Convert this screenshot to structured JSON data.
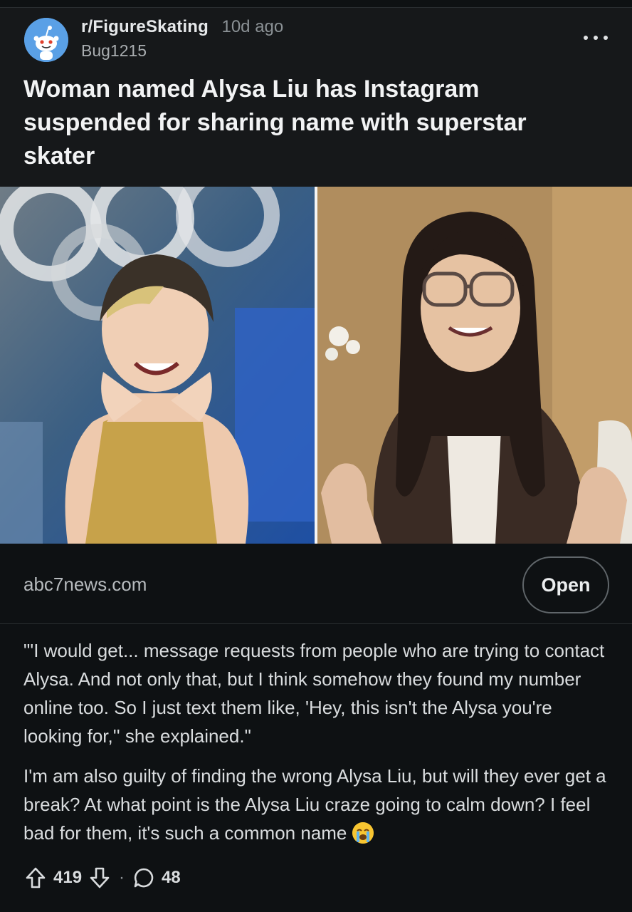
{
  "post": {
    "subreddit": "r/FigureSkating",
    "age": "10d ago",
    "author": "Bug1215",
    "title": "Woman named Alysa Liu has Instagram suspended for sharing name with superstar skater"
  },
  "link": {
    "domain": "abc7news.com",
    "open_label": "Open"
  },
  "body": {
    "quote": "\"'I would get... message requests from people who are trying to contact Alysa. And not only that, but I think somehow they found my number online too. So I just text them like, 'Hey, this isn't the Alysa you're looking for,'' she explained.\"",
    "text": "I'm am also guilty of finding the wrong Alysa Liu, but will they ever get a break? At what point is the Alysa Liu craze going to calm down? I feel bad for them, it's such a common name"
  },
  "actions": {
    "upvotes": "419",
    "separator": "·",
    "comments": "48"
  },
  "icons": {
    "avatar": "reddit-snoo-icon",
    "more": "more-horizontal-icon",
    "upvote": "upvote-arrow-icon",
    "downvote": "downvote-arrow-icon",
    "comment": "comment-bubble-icon",
    "emoji": "loudly-crying-face-emoji"
  },
  "colors": {
    "background": "#0e1113",
    "header_background": "#16181a",
    "avatar_blue": "#5aa0e6"
  }
}
